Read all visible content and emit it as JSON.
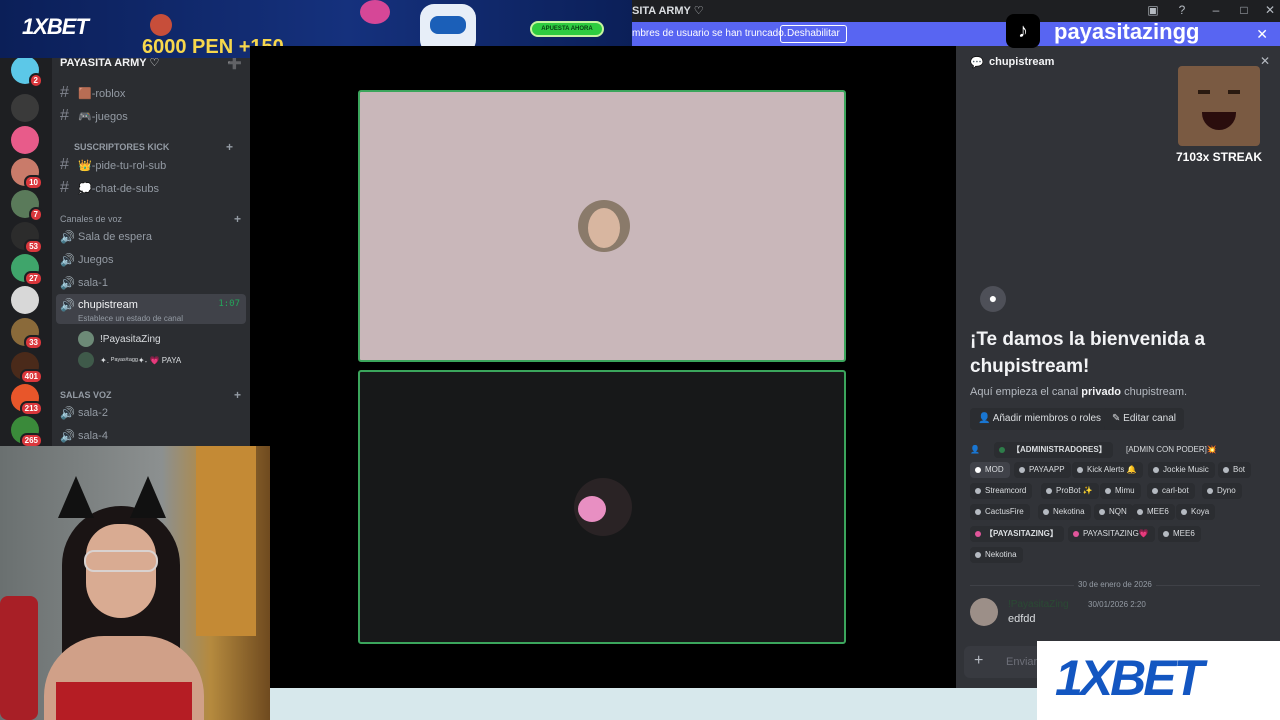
{
  "window": {
    "title": "SITA ARMY ♡",
    "controls": [
      "▣",
      "?",
      "–",
      "□",
      "✕"
    ]
  },
  "notice": {
    "text": "mbres de usuario se han truncado.",
    "button": "Deshabilitar",
    "close": "✕"
  },
  "ad": {
    "brand": "1XBET",
    "promo": "6000 PEN +150",
    "cta": "APUESTA AHORA"
  },
  "server": {
    "name": "PAYASITA ARMY ♡",
    "rail_badges": [
      "2",
      "10",
      "7",
      "53",
      "27",
      "33",
      "401",
      "213",
      "265"
    ]
  },
  "sidebar": {
    "text_channels_top": [
      {
        "name": "🟫-roblox"
      },
      {
        "name": "🎮-juegos"
      }
    ],
    "cat_subs": "SUSCRIPTORES KICK",
    "text_channels_subs": [
      {
        "name": "👑-pide-tu-rol-sub"
      },
      {
        "name": "💭-chat-de-subs"
      }
    ],
    "cat_voice": "Canales de voz",
    "voice_channels": [
      {
        "name": "Sala de espera"
      },
      {
        "name": "Juegos"
      },
      {
        "name": "sala-1"
      }
    ],
    "active_channel": {
      "name": "chupistream",
      "time": "1:07",
      "status": "Establece un estado de canal"
    },
    "voice_users": [
      {
        "name": "!PayasitaZing"
      },
      {
        "name": "✦. ᴾᵃʸᵃˢⁱᵗᵃᵍᵍ✦˖ 💗 PAYA"
      }
    ],
    "cat_salas": "SALAS VOZ",
    "salas": [
      {
        "name": "sala-2"
      },
      {
        "name": "sala-4"
      }
    ]
  },
  "chat": {
    "channel": "chupistream",
    "welcome": "¡Te damos la bienvenida a chupistream!",
    "intro_pre": "Aquí empieza el canal ",
    "intro_bold": "privado",
    "intro_post": " chupistream.",
    "btn_add": "Añadir miembros o roles",
    "btn_edit": "Editar canal",
    "roles": [
      "【ADMINISTRADORES】",
      "[ADMIN CON PODER]💥",
      "MOD",
      "PAYAAPP",
      "Kick Alerts 🔔",
      "Jockie Music",
      "Bot",
      "Streamcord",
      "ProBot ✨",
      "Mimu",
      "carl-bot",
      "Dyno",
      "CactusFire",
      "Nekotina",
      "NQN",
      "MEE6",
      "Koya",
      "【PAYASITAZING】",
      "PAYASITAZING💗",
      "MEE6",
      "Nekotina"
    ],
    "date_separator": "30 de enero de 2026",
    "message": {
      "author": "!PayasitaZing",
      "time": "30/01/2026 2:20",
      "text": "edfdd"
    },
    "input_placeholder": "Enviar"
  },
  "overlay": {
    "tiktok_name": "payasitazingg",
    "streak": "7103x STREAK",
    "logo_bottom": "1XBET"
  },
  "colors": {
    "accent": "#5865f2",
    "speaking": "#3ba55c",
    "brand_blue": "#1356c1"
  }
}
